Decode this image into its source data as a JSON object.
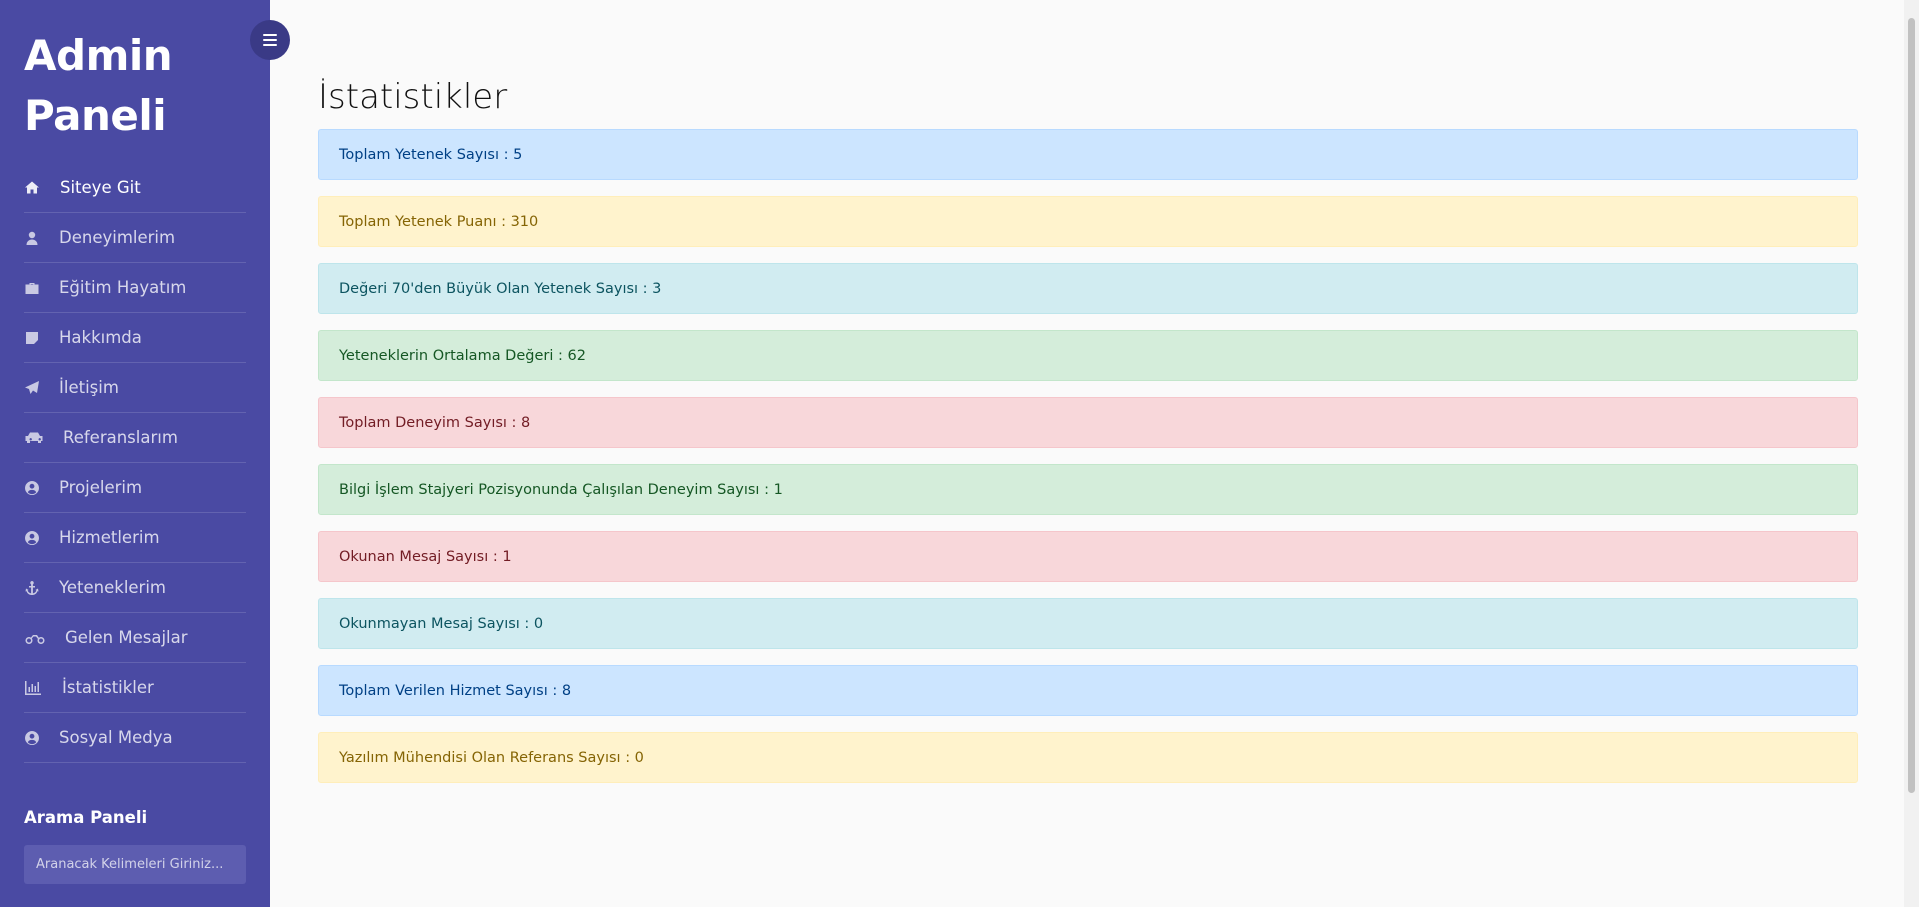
{
  "sidebar": {
    "brand": "Admin Paneli",
    "items": [
      {
        "label": "Siteye Git",
        "icon": "home-icon"
      },
      {
        "label": "Deneyimlerim",
        "icon": "user-icon"
      },
      {
        "label": "Eğitim Hayatım",
        "icon": "briefcase-icon"
      },
      {
        "label": "Hakkımda",
        "icon": "sticky-note-icon"
      },
      {
        "label": "İletişim",
        "icon": "paper-plane-icon"
      },
      {
        "label": "Referanslarım",
        "icon": "car-icon"
      },
      {
        "label": "Projelerim",
        "icon": "user-circle-icon"
      },
      {
        "label": "Hizmetlerim",
        "icon": "user-circle-icon"
      },
      {
        "label": "Yeteneklerim",
        "icon": "anchor-icon"
      },
      {
        "label": "Gelen Mesajlar",
        "icon": "motorcycle-icon"
      },
      {
        "label": "İstatistikler",
        "icon": "bar-chart-icon"
      },
      {
        "label": "Sosyal Medya",
        "icon": "user-circle-icon"
      }
    ],
    "search": {
      "title": "Arama Paneli",
      "placeholder": "Aranacak Kelimeleri Giriniz..."
    }
  },
  "main": {
    "title": "İstatistikler",
    "stats": [
      {
        "text": "Toplam Yetenek Sayısı : 5",
        "variant": "primary"
      },
      {
        "text": "Toplam Yetenek Puanı : 310",
        "variant": "warning"
      },
      {
        "text": "Değeri 70'den Büyük Olan Yetenek Sayısı : 3",
        "variant": "info"
      },
      {
        "text": "Yeteneklerin Ortalama Değeri : 62",
        "variant": "success"
      },
      {
        "text": "Toplam Deneyim Sayısı : 8",
        "variant": "danger"
      },
      {
        "text": "Bilgi İşlem Stajyeri Pozisyonunda Çalışılan Deneyim Sayısı : 1",
        "variant": "success"
      },
      {
        "text": "Okunan Mesaj Sayısı : 1",
        "variant": "danger"
      },
      {
        "text": "Okunmayan Mesaj Sayısı : 0",
        "variant": "info"
      },
      {
        "text": "Toplam Verilen Hizmet Sayısı : 8",
        "variant": "primary"
      },
      {
        "text": "Yazılım Mühendisi Olan Referans Sayısı : 0",
        "variant": "warning"
      }
    ]
  },
  "colors": {
    "sidebar_bg": "#4a4aa3",
    "toggle_bg": "#3a3a86",
    "page_bg": "#fafafa"
  }
}
